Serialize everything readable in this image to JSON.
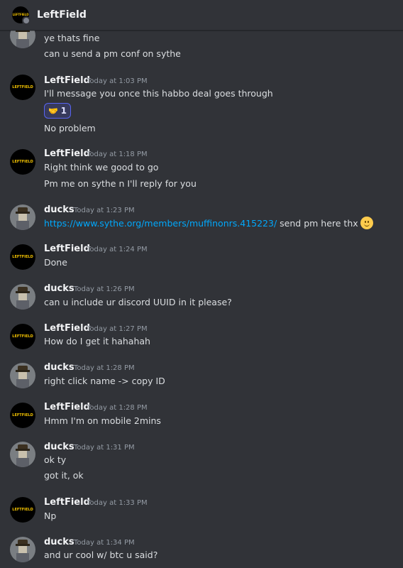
{
  "header": {
    "channel_name": "LeftField",
    "avatar_text": "LEFTFIELD"
  },
  "logo_text": "LEFTFIELD",
  "messages": [
    {
      "lines": [
        "ye thats fine",
        "can u send a pm conf on sythe"
      ]
    },
    {
      "author": "LeftField",
      "time": "Today at 1:03 PM",
      "lines": [
        "I'll message you once this habbo  deal goes through",
        "No problem"
      ],
      "reaction": {
        "emoji": "handshake",
        "count": "1"
      }
    },
    {
      "author": "LeftField",
      "time": "Today at 1:18 PM",
      "lines": [
        "Right think we good to go",
        "Pm me on sythe n I'll reply for you"
      ]
    },
    {
      "author": "ducks",
      "time": "Today at 1:23 PM",
      "link": "https://www.sythe.org/members/muffinonrs.415223/",
      "lines": [
        " send pm here thx"
      ]
    },
    {
      "author": "LeftField",
      "time": "Today at 1:24 PM",
      "lines": [
        "Done"
      ]
    },
    {
      "author": "ducks",
      "time": "Today at 1:26 PM",
      "lines": [
        "can u include ur discord UUID in it please?"
      ]
    },
    {
      "author": "LeftField",
      "time": "Today at 1:27 PM",
      "lines": [
        "How do I get it hahahah"
      ]
    },
    {
      "author": "ducks",
      "time": "Today at 1:28 PM",
      "lines": [
        "right click name -> copy ID"
      ]
    },
    {
      "author": "LeftField",
      "time": "Today at 1:28 PM",
      "lines": [
        "Hmm I'm on mobile 2mins"
      ]
    },
    {
      "author": "ducks",
      "time": "Today at 1:31 PM",
      "lines": [
        "ok ty",
        "got it, ok"
      ]
    },
    {
      "author": "LeftField",
      "time": "Today at 1:33 PM",
      "lines": [
        "Np"
      ]
    },
    {
      "author": "ducks",
      "time": "Today at 1:34 PM",
      "lines": [
        "and ur cool w/ btc u said?"
      ]
    }
  ],
  "colors": {
    "background": "#313338",
    "link": "#00a8fc",
    "timestamp": "#949ba4",
    "reaction_border": "#5865f2"
  }
}
